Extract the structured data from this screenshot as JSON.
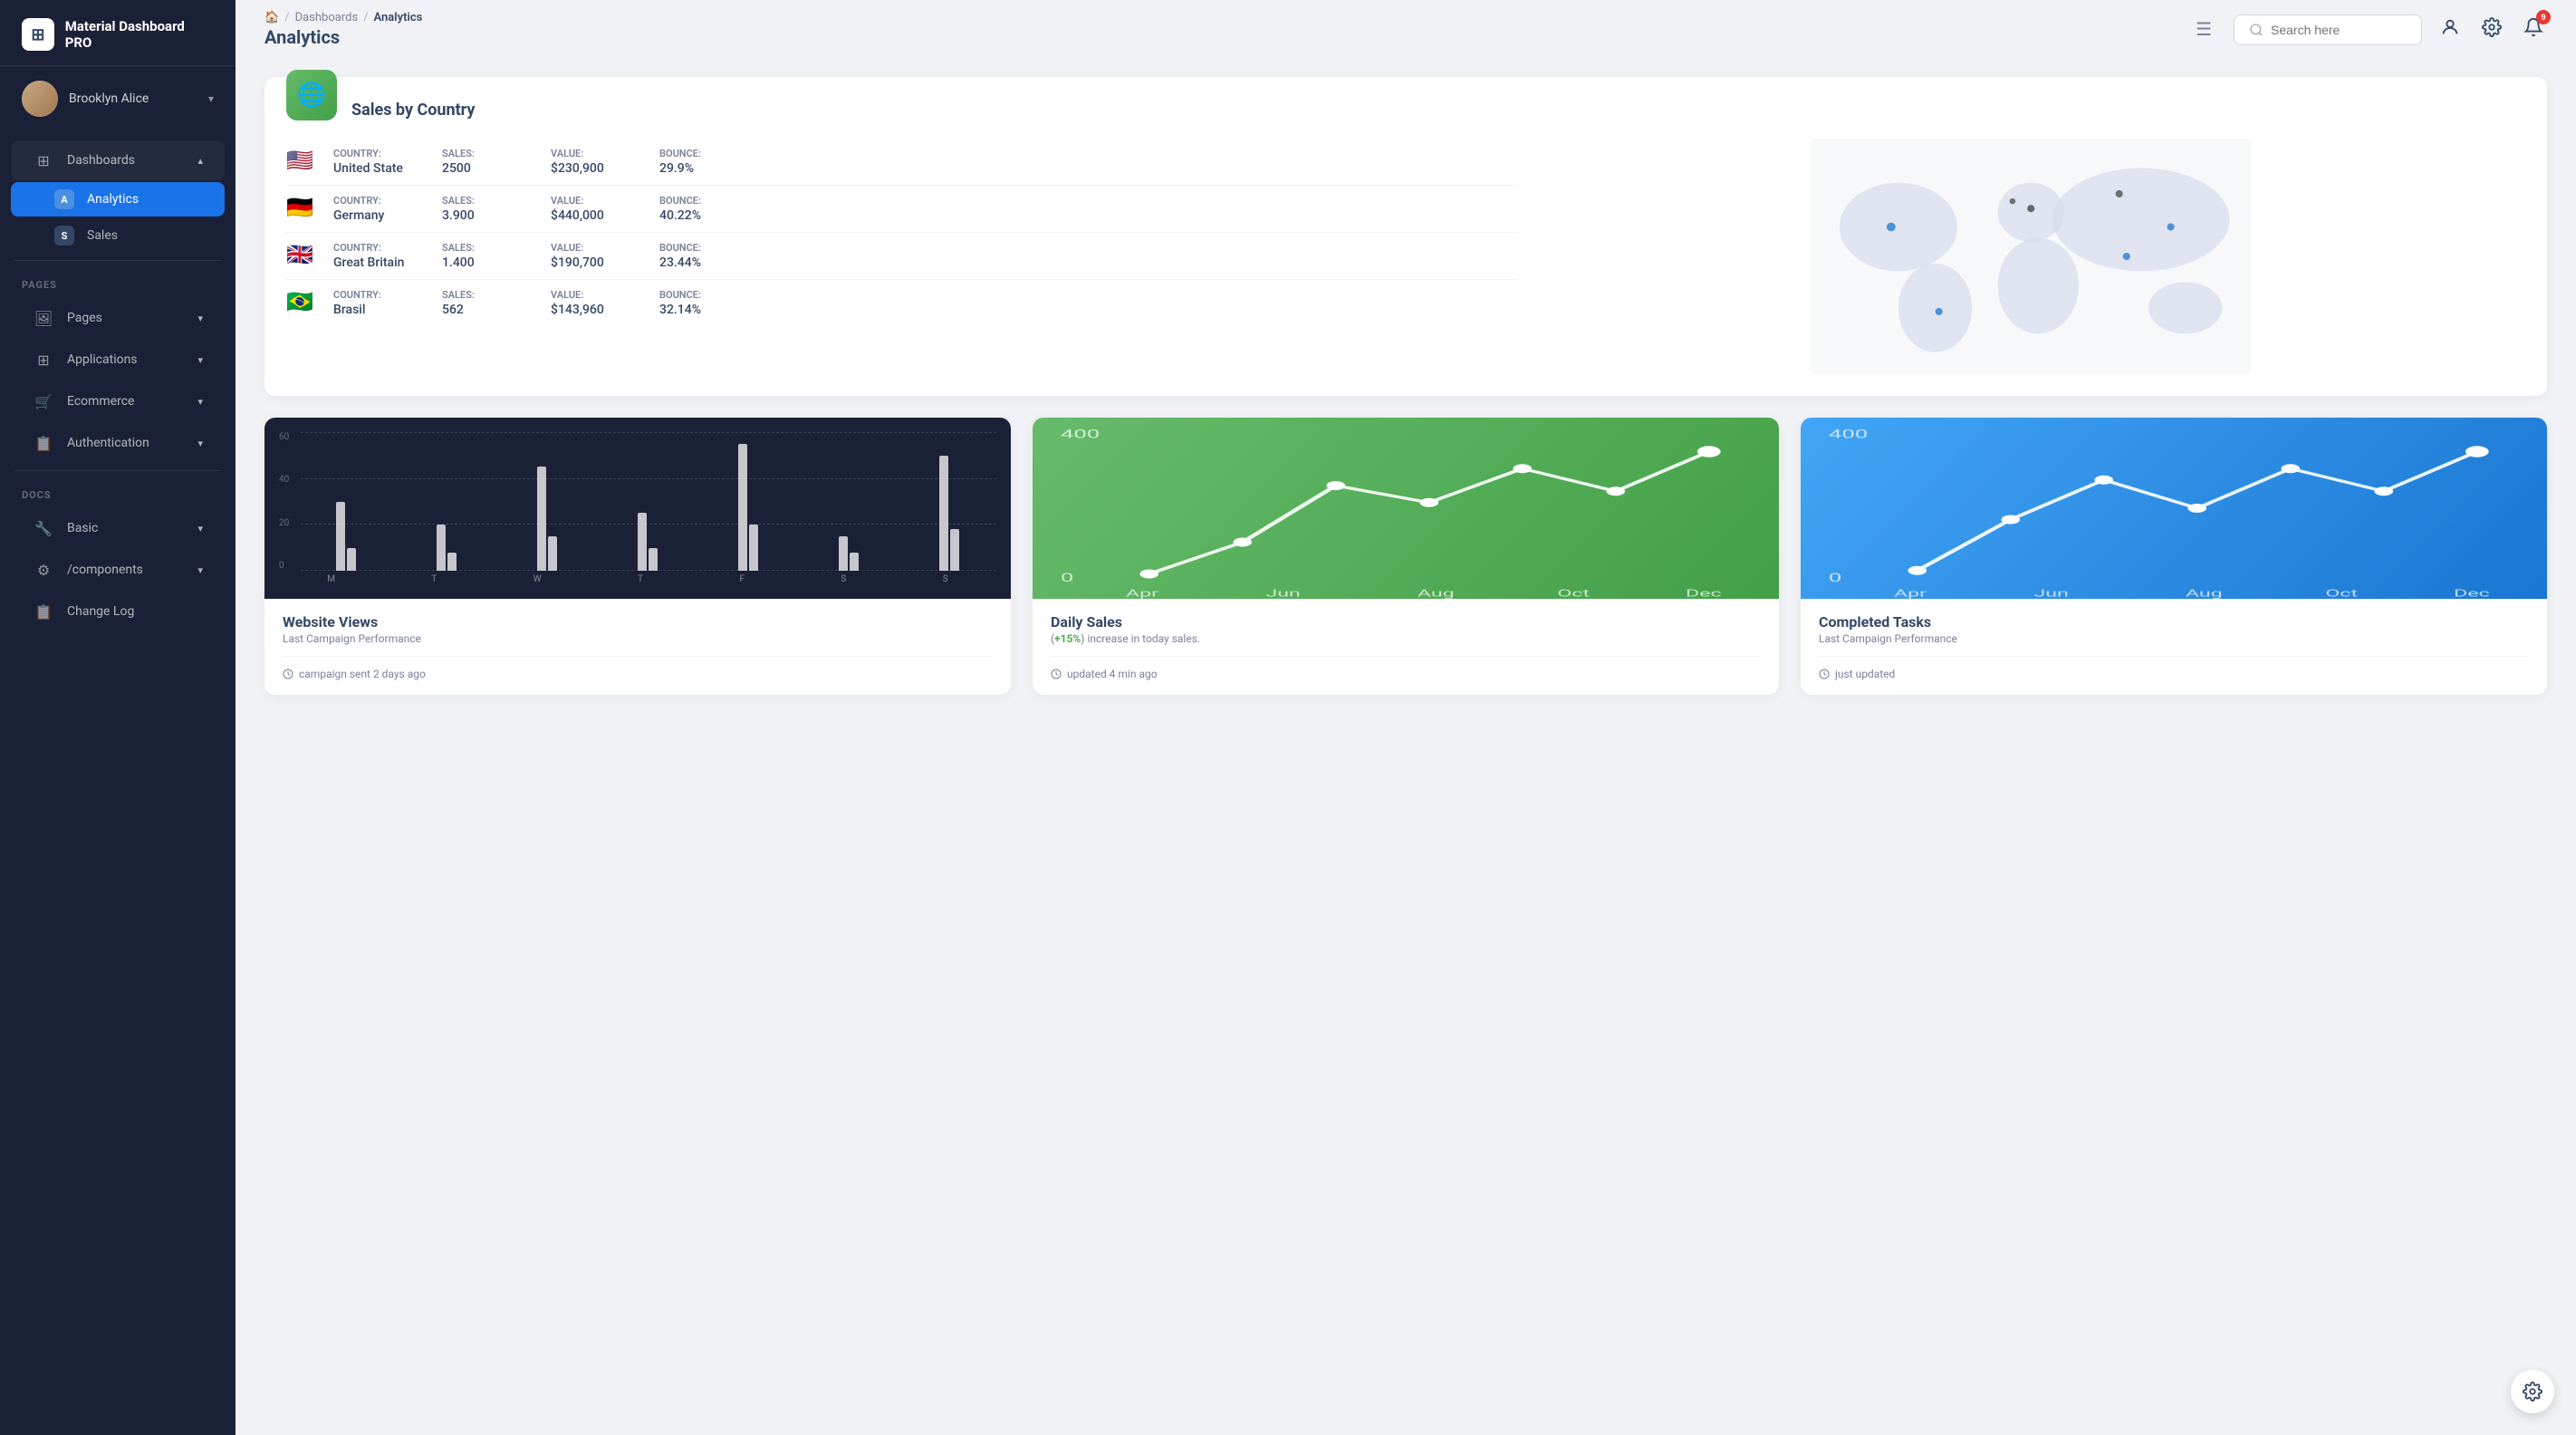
{
  "sidebar": {
    "logo_text": "Material Dashboard PRO",
    "logo_icon": "⊞",
    "user": {
      "name": "Brooklyn Alice",
      "chevron": "▾"
    },
    "dashboards": {
      "label": "Dashboards",
      "icon": "⊞",
      "chevron": "▴",
      "items": [
        {
          "key": "analytics",
          "letter": "A",
          "label": "Analytics",
          "active": true
        },
        {
          "key": "sales",
          "letter": "S",
          "label": "Sales",
          "active": false
        }
      ]
    },
    "pages_label": "PAGES",
    "pages_items": [
      {
        "key": "pages",
        "icon": "🖼",
        "label": "Pages",
        "chevron": "▾"
      },
      {
        "key": "applications",
        "icon": "⊞",
        "label": "Applications",
        "chevron": "▾"
      },
      {
        "key": "ecommerce",
        "icon": "🛒",
        "label": "Ecommerce",
        "chevron": "▾"
      },
      {
        "key": "authentication",
        "icon": "📋",
        "label": "Authentication",
        "chevron": "▾"
      }
    ],
    "docs_label": "DOCS",
    "docs_items": [
      {
        "key": "basic",
        "icon": "🔧",
        "label": "Basic",
        "chevron": "▾"
      },
      {
        "key": "components",
        "icon": "⚙",
        "label": "/components",
        "chevron": "▾"
      },
      {
        "key": "changelog",
        "icon": "📋",
        "label": "Change Log"
      }
    ]
  },
  "topbar": {
    "home_icon": "🏠",
    "breadcrumb_separator": "/",
    "breadcrumb_middle": "Dashboards",
    "breadcrumb_current": "Analytics",
    "page_title": "Analytics",
    "menu_icon": "☰",
    "search_placeholder": "Search here",
    "notification_count": "9"
  },
  "sales_by_country": {
    "title": "Sales by Country",
    "icon": "🌐",
    "rows": [
      {
        "flag": "🇺🇸",
        "country_label": "Country:",
        "country": "United State",
        "sales_label": "Sales:",
        "sales": "2500",
        "value_label": "Value:",
        "value": "$230,900",
        "bounce_label": "Bounce:",
        "bounce": "29.9%"
      },
      {
        "flag": "🇩🇪",
        "country_label": "Country:",
        "country": "Germany",
        "sales_label": "Sales:",
        "sales": "3.900",
        "value_label": "Value:",
        "value": "$440,000",
        "bounce_label": "Bounce:",
        "bounce": "40.22%"
      },
      {
        "flag": "🇬🇧",
        "country_label": "Country:",
        "country": "Great Britain",
        "sales_label": "Sales:",
        "sales": "1.400",
        "value_label": "Value:",
        "value": "$190,700",
        "bounce_label": "Bounce:",
        "bounce": "23.44%"
      },
      {
        "flag": "🇧🇷",
        "country_label": "Country:",
        "country": "Brasil",
        "sales_label": "Sales:",
        "sales": "562",
        "value_label": "Value:",
        "value": "$143,960",
        "bounce_label": "Bounce:",
        "bounce": "32.14%"
      }
    ]
  },
  "chart_cards": [
    {
      "key": "website-views",
      "theme": "dark",
      "title": "Website Views",
      "subtitle": "Last Campaign Performance",
      "footer": "campaign sent 2 days ago",
      "y_labels": [
        "60",
        "40",
        "20",
        "0"
      ],
      "x_labels": [
        "M",
        "T",
        "W",
        "T",
        "F",
        "S",
        "S"
      ],
      "bars": [
        [
          30,
          10
        ],
        [
          20,
          8
        ],
        [
          45,
          15
        ],
        [
          25,
          10
        ],
        [
          55,
          20
        ],
        [
          15,
          8
        ],
        [
          50,
          18
        ]
      ]
    },
    {
      "key": "daily-sales",
      "theme": "green",
      "title": "Daily Sales",
      "subtitle": "(+15%) increase in today sales.",
      "highlight": "+15%",
      "footer": "updated 4 min ago",
      "y_labels": [
        "400",
        "0"
      ],
      "x_labels": [
        "Apr",
        "Jun",
        "Aug",
        "Oct",
        "Dec"
      ],
      "points": [
        10,
        30,
        70,
        55,
        80,
        65,
        90
      ]
    },
    {
      "key": "completed-tasks",
      "theme": "blue",
      "title": "Completed Tasks",
      "subtitle": "Last Campaign Performance",
      "footer": "just updated",
      "y_labels": [
        "400",
        "0"
      ],
      "x_labels": [
        "Apr",
        "Jun",
        "Aug",
        "Oct",
        "Dec"
      ],
      "points": [
        15,
        50,
        80,
        60,
        90,
        70,
        95
      ]
    }
  ]
}
